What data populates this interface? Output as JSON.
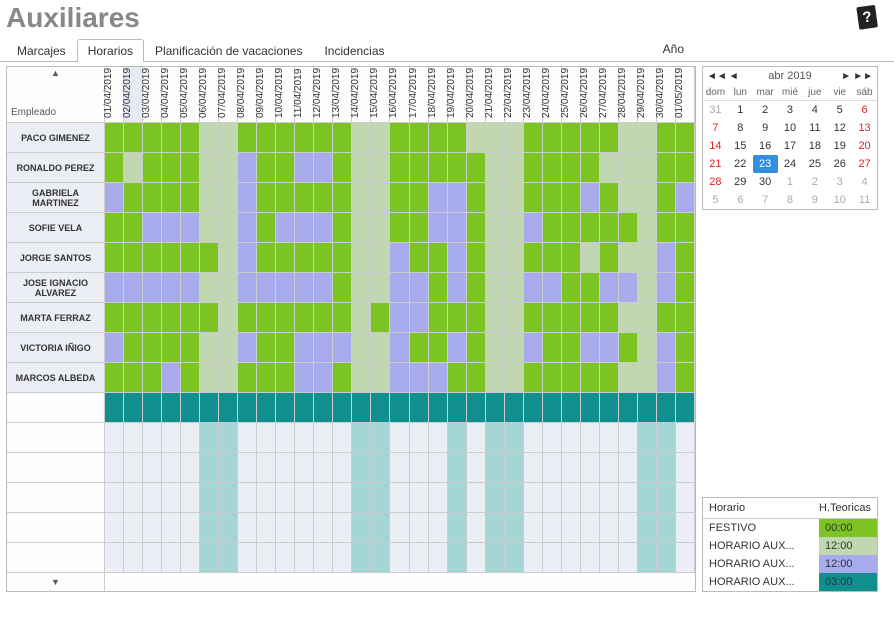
{
  "title": "Auxiliares",
  "year_label": "Año",
  "tabs": [
    {
      "label": "Marcajes",
      "active": false
    },
    {
      "label": "Horarios",
      "active": true
    },
    {
      "label": "Planificación de vacaciones",
      "active": false
    },
    {
      "label": "Incidencias",
      "active": false
    }
  ],
  "grid": {
    "employee_header": "Empleado",
    "scroll_up": "▲",
    "scroll_down": "▼",
    "dates": [
      "01/04/2019",
      "02/04/2019",
      "03/04/2019",
      "04/04/2019",
      "05/04/2019",
      "06/04/2019",
      "07/04/2019",
      "08/04/2019",
      "09/04/2019",
      "10/04/2019",
      "11/04/2019",
      "12/04/2019",
      "13/04/2019",
      "14/04/2019",
      "15/04/2019",
      "16/04/2019",
      "17/04/2019",
      "18/04/2019",
      "19/04/2019",
      "20/04/2019",
      "21/04/2019",
      "22/04/2019",
      "23/04/2019",
      "24/04/2019",
      "25/04/2019",
      "26/04/2019",
      "27/04/2019",
      "28/04/2019",
      "29/04/2019",
      "30/04/2019",
      "01/05/2019"
    ],
    "highlight_index": 1,
    "employees": [
      "PACO GIMENEZ",
      "RONALDO PEREZ",
      "GABRIELA MARTINEZ",
      "SOFIE VELA",
      "JORGE SANTOS",
      "JOSE IGNACIO ALVAREZ",
      "MARTA FERRAZ",
      "VICTORIA IÑIGO",
      "MARCOS ALBEDA"
    ],
    "colors": {
      "g": "c-green",
      "p": "c-pale",
      "l": "c-lilac",
      "t": "c-teal",
      "u": "c-lteal",
      "v": "c-vpale"
    },
    "rows": [
      "gggggppggggggppggggpppgggggppgg",
      "gpgggpplggllgppgggggppggggpppgg",
      "lggggpplgggggppggllgppggglgppgl",
      "gglllpplglllgppggllgpplgggggpgg",
      "ggggggplgggggpplgglgppgggpgpplg",
      "lllllpplllllgppllglgppllggllplg",
      "ggggggpggggggpgllgggppgggggppgg",
      "lggggpplgglllpplgglgpplggllgplg",
      "ggglgppgggllgpplllggppgggggpplg"
    ],
    "extra_rows": [
      {
        "type": "solid",
        "color": "t"
      },
      {
        "type": "pattern",
        "colors": "vvvvvuuvvvvvvuuvvvuvuuvvvvvvuuv",
        "repeat": 5
      }
    ]
  },
  "calendar": {
    "title": "abr 2019",
    "dow": [
      "dom",
      "lun",
      "mar",
      "mié",
      "jue",
      "vie",
      "sáb"
    ],
    "nav_prev_fast": "◀◀",
    "nav_prev": "◀",
    "nav_next": "▶",
    "nav_next_fast": "▶▶",
    "selected": 23,
    "weeks": [
      [
        {
          "n": 31,
          "out": true
        },
        {
          "n": 1
        },
        {
          "n": 2
        },
        {
          "n": 3
        },
        {
          "n": 4
        },
        {
          "n": 5
        },
        {
          "n": 6,
          "red": true
        }
      ],
      [
        {
          "n": 7,
          "red": true
        },
        {
          "n": 8
        },
        {
          "n": 9
        },
        {
          "n": 10
        },
        {
          "n": 11
        },
        {
          "n": 12
        },
        {
          "n": 13,
          "red": true
        }
      ],
      [
        {
          "n": 14,
          "red": true
        },
        {
          "n": 15
        },
        {
          "n": 16
        },
        {
          "n": 17
        },
        {
          "n": 18
        },
        {
          "n": 19
        },
        {
          "n": 20,
          "red": true
        }
      ],
      [
        {
          "n": 21,
          "red": true
        },
        {
          "n": 22
        },
        {
          "n": 23,
          "sel": true
        },
        {
          "n": 24
        },
        {
          "n": 25
        },
        {
          "n": 26
        },
        {
          "n": 27,
          "red": true
        }
      ],
      [
        {
          "n": 28,
          "red": true
        },
        {
          "n": 29
        },
        {
          "n": 30
        },
        {
          "n": 1,
          "out": true
        },
        {
          "n": 2,
          "out": true
        },
        {
          "n": 3,
          "out": true
        },
        {
          "n": 4,
          "out": true
        }
      ],
      [
        {
          "n": 5,
          "out": true
        },
        {
          "n": 6,
          "out": true
        },
        {
          "n": 7,
          "out": true
        },
        {
          "n": 8,
          "out": true
        },
        {
          "n": 9,
          "out": true
        },
        {
          "n": 10,
          "out": true
        },
        {
          "n": 11,
          "out": true
        }
      ]
    ]
  },
  "legend": {
    "headers": {
      "name": "Horario",
      "hours": "H.Teoricas"
    },
    "rows": [
      {
        "name": "FESTIVO",
        "hours": "00:00",
        "color": "c-green"
      },
      {
        "name": "HORARIO AUX...",
        "hours": "12:00",
        "color": "c-pale"
      },
      {
        "name": "HORARIO AUX...",
        "hours": "12:00",
        "color": "c-lilac"
      },
      {
        "name": "HORARIO AUX...",
        "hours": "03:00",
        "color": "c-teal"
      }
    ]
  }
}
